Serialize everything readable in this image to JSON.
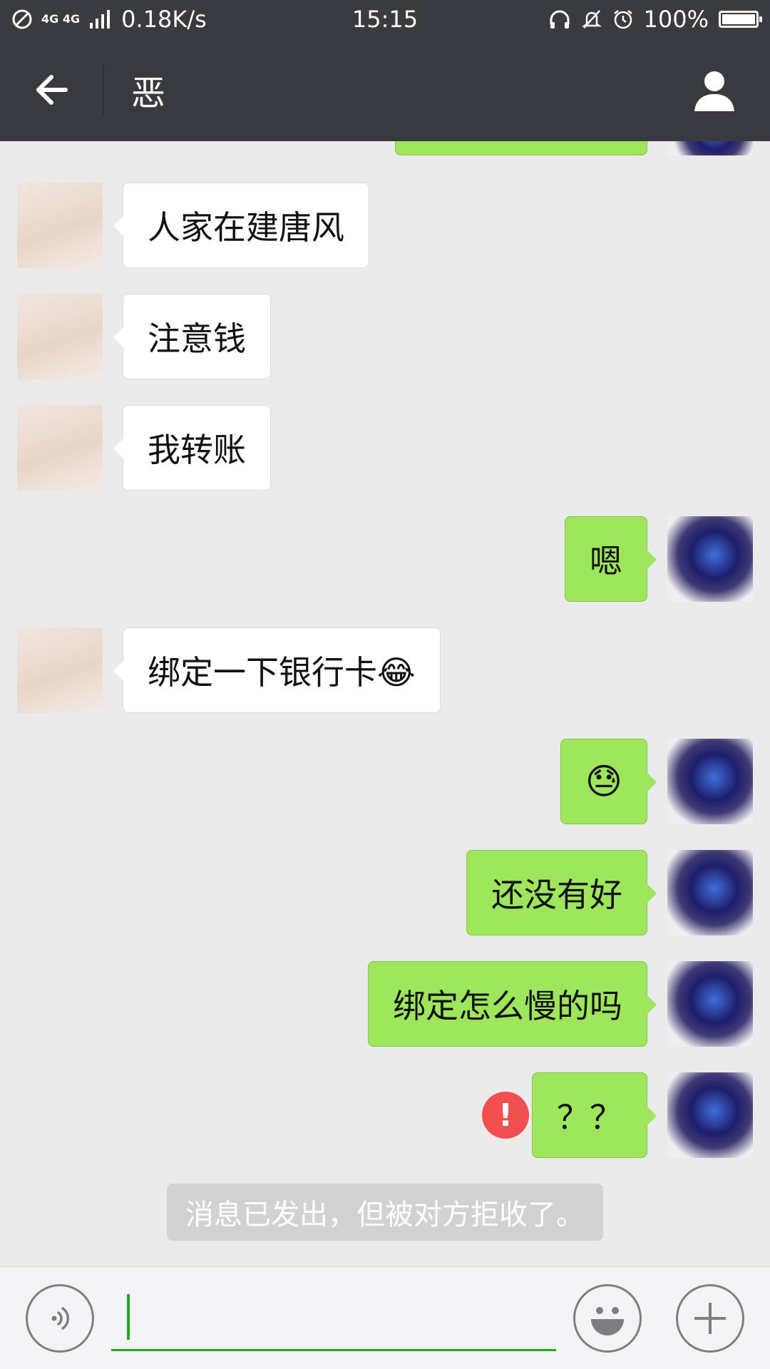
{
  "status_bar": {
    "network_type": "4G 4G",
    "speed": "0.18K/s",
    "time": "15:15",
    "battery": "100%",
    "battery_fraction": 1.0,
    "icons": [
      "dnd-icon",
      "signal-icon",
      "headphones-icon",
      "bell-off-icon",
      "alarm-icon",
      "battery-icon"
    ]
  },
  "header": {
    "title": "恶",
    "back_icon": "arrow-left-icon",
    "profile_icon": "person-icon"
  },
  "messages": [
    {
      "side": "left",
      "text": "人家在建唐风"
    },
    {
      "side": "left",
      "text": "注意钱"
    },
    {
      "side": "left",
      "text": "我转账"
    },
    {
      "side": "right",
      "text": "嗯"
    },
    {
      "side": "left",
      "text": "绑定一下银行卡😂"
    },
    {
      "side": "right",
      "text": "😓"
    },
    {
      "side": "right",
      "text": "还没有好"
    },
    {
      "side": "right",
      "text": "绑定怎么慢的吗"
    },
    {
      "side": "right",
      "text": "？？",
      "status": "failed"
    }
  ],
  "notice": "消息已发出，但被对方拒收了。",
  "input_bar": {
    "value": "",
    "icons": [
      "voice-icon",
      "emoji-icon",
      "plus-icon"
    ]
  },
  "colors": {
    "header_bg": "#393a3f",
    "chat_bg": "#ebebeb",
    "sent_bubble": "#9ee65c",
    "received_bubble": "#ffffff",
    "error": "#f25050",
    "input_accent": "#1aad19"
  }
}
